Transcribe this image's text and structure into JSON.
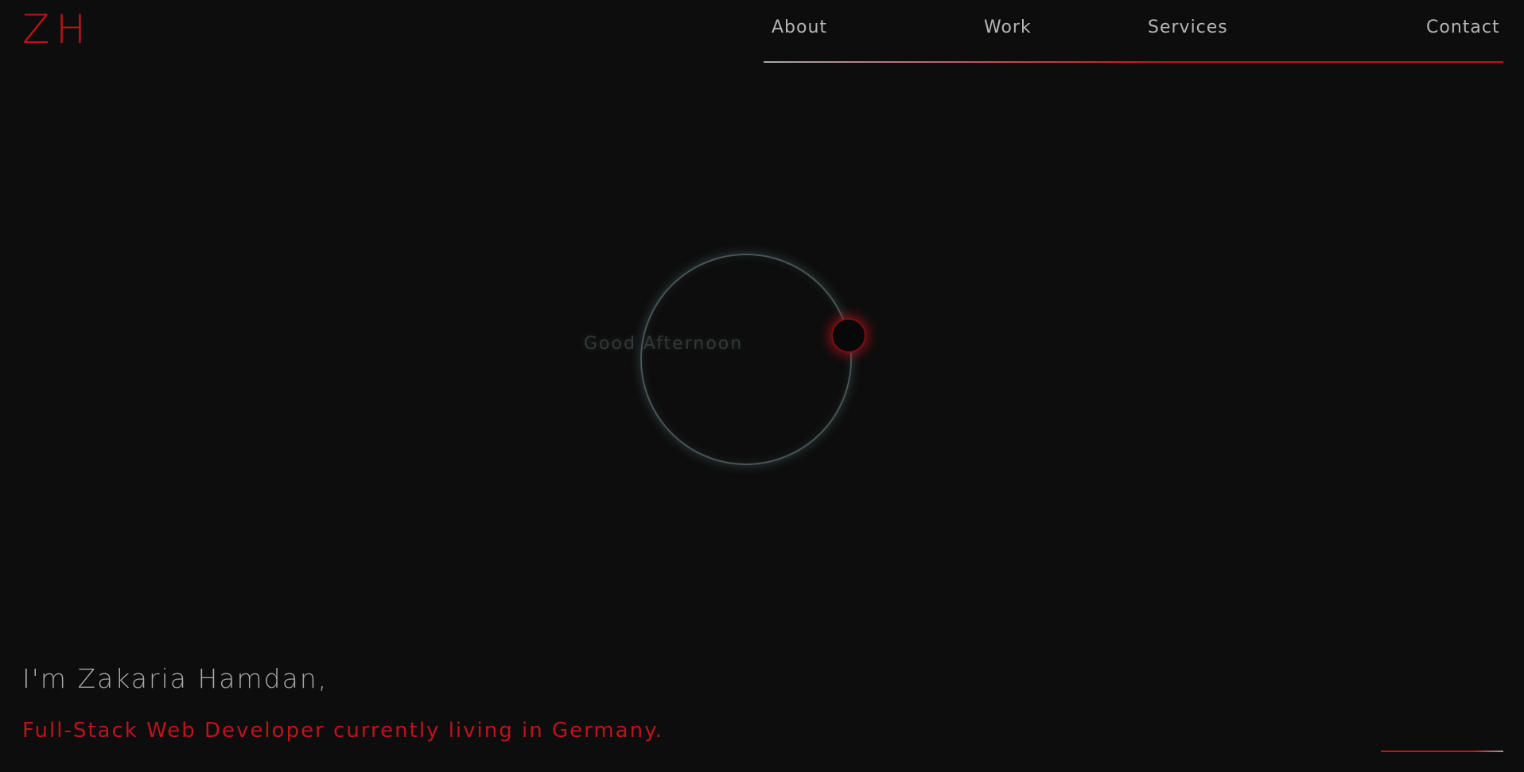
{
  "brand": {
    "logo_text": "ZH",
    "accent_color": "#c0121c",
    "background_color": "#0d0d0d"
  },
  "nav": {
    "items": [
      {
        "label": "About"
      },
      {
        "label": "Work"
      },
      {
        "label": "Services"
      },
      {
        "label": "Contact"
      }
    ]
  },
  "hero": {
    "greeting": "Good Afternoon"
  },
  "intro": {
    "name_line": "I'm Zakaria Hamdan,",
    "role_line": "Full-Stack Web Developer currently living in Germany."
  }
}
